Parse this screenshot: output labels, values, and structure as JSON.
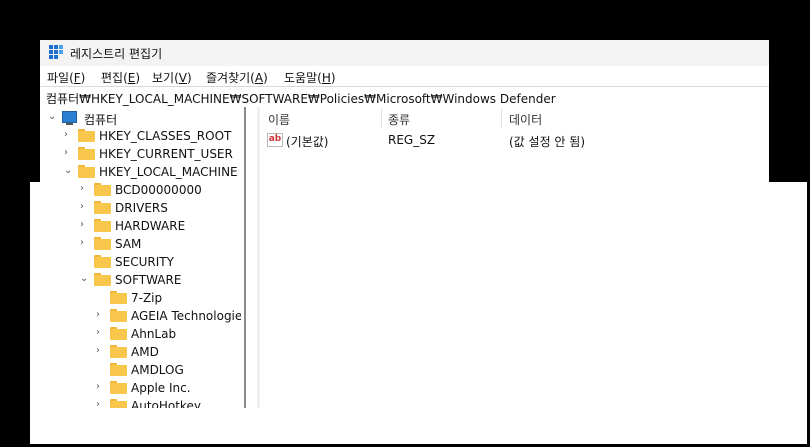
{
  "window": {
    "title": "레지스트리 편집기"
  },
  "menu": [
    {
      "label": "파일(",
      "acc": "F",
      "tail": ")"
    },
    {
      "label": "편집(",
      "acc": "E",
      "tail": ")"
    },
    {
      "label": "보기(",
      "acc": "V",
      "tail": ")"
    },
    {
      "label": "즐겨찾기(",
      "acc": "A",
      "tail": ")"
    },
    {
      "label": "도움말(",
      "acc": "H",
      "tail": ")"
    }
  ],
  "address": {
    "path": "컴퓨터₩HKEY_LOCAL_MACHINE₩SOFTWARE₩Policies₩Microsoft₩Windows Defender"
  },
  "tree": {
    "root": "컴퓨터",
    "nodes": [
      "HKEY_CLASSES_ROOT",
      "HKEY_CURRENT_USER",
      "HKEY_LOCAL_MACHINE",
      "BCD00000000",
      "DRIVERS",
      "HARDWARE",
      "SAM",
      "SECURITY",
      "SOFTWARE",
      "7-Zip",
      "AGEIA Technologies",
      "AhnLab",
      "AMD",
      "AMDLOG",
      "Apple Inc.",
      "AutoHotkey"
    ]
  },
  "list": {
    "columns": [
      "이름",
      "종류",
      "데이터"
    ],
    "rows": [
      {
        "name": "(기본값)",
        "type": "REG_SZ",
        "data": "(값 설정 안 됨)",
        "icon": "string-value-icon"
      }
    ]
  }
}
